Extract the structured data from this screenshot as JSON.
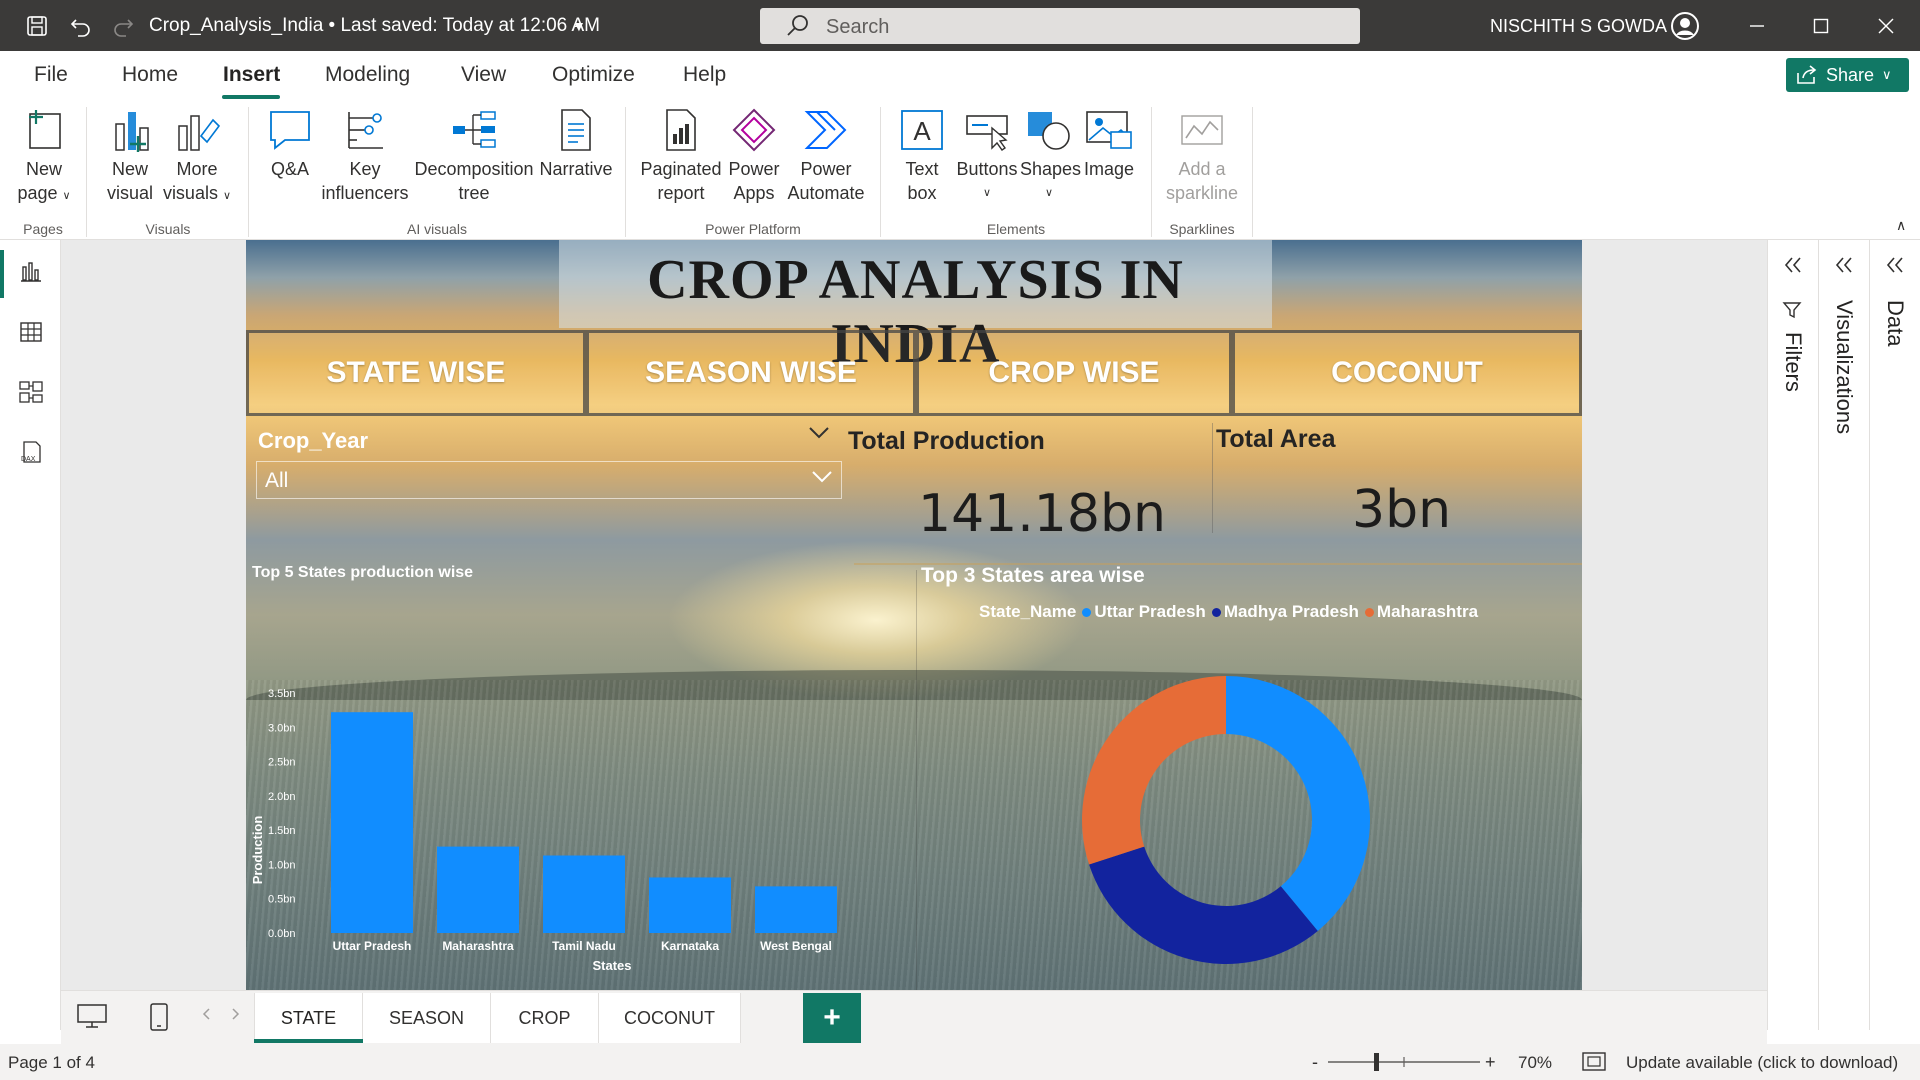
{
  "titlebar": {
    "doc_title": "Crop_Analysis_India • Last saved: Today at 12:06 AM",
    "search_placeholder": "Search",
    "user_name": "NISCHITH S GOWDA"
  },
  "menu": {
    "tabs": [
      "File",
      "Home",
      "Insert",
      "Modeling",
      "View",
      "Optimize",
      "Help"
    ],
    "active": "Insert",
    "share_label": "Share"
  },
  "ribbon": {
    "new_page": [
      "New",
      "page"
    ],
    "new_visual": [
      "New",
      "visual"
    ],
    "more_visuals": [
      "More",
      "visuals"
    ],
    "qa": [
      "Q&A"
    ],
    "key_influencers": [
      "Key",
      "influencers"
    ],
    "decomposition_tree": [
      "Decomposition",
      "tree"
    ],
    "narrative": [
      "Narrative"
    ],
    "paginated_report": [
      "Paginated",
      "report"
    ],
    "power_apps": [
      "Power",
      "Apps"
    ],
    "power_automate": [
      "Power",
      "Automate"
    ],
    "text_box": [
      "Text",
      "box"
    ],
    "buttons": [
      "Buttons"
    ],
    "shapes": [
      "Shapes"
    ],
    "image": [
      "Image"
    ],
    "add_sparkline": [
      "Add a",
      "sparkline"
    ],
    "groups": {
      "pages": "Pages",
      "visuals": "Visuals",
      "ai_visuals": "AI visuals",
      "power_platform": "Power Platform",
      "elements": "Elements",
      "sparklines": "Sparklines"
    }
  },
  "report": {
    "title": "CROP ANALYSIS IN INDIA",
    "nav_buttons": [
      "STATE WISE",
      "SEASON WISE",
      "CROP WISE",
      "COCONUT"
    ],
    "slicer": {
      "label": "Crop_Year",
      "value": "All"
    },
    "kpis": {
      "production_label": "Total Production",
      "production_value": "141.18bn",
      "area_label": "Total Area",
      "area_value": "3bn"
    },
    "bar_title": "Top 5 States production wise",
    "donut_title": "Top 3 States area wise",
    "legend_title": "State_Name"
  },
  "chart_data": [
    {
      "type": "bar",
      "title": "Top 5 States production wise",
      "categories": [
        "Uttar Pradesh",
        "Maharashtra",
        "Tamil Nadu",
        "Karnataka",
        "West Bengal"
      ],
      "values": [
        3.22,
        1.26,
        1.13,
        0.81,
        0.68
      ],
      "unit": "bn",
      "xlabel": "States",
      "ylabel": "Production",
      "ylim": [
        0,
        3.5
      ],
      "yticks": [
        "0.0bn",
        "0.5bn",
        "1.0bn",
        "1.5bn",
        "2.0bn",
        "2.5bn",
        "3.0bn",
        "3.5bn"
      ],
      "color": "#118dff"
    },
    {
      "type": "pie",
      "title": "Top 3 States area wise",
      "legend_title": "State_Name",
      "labels": [
        "Uttar Pradesh",
        "Madhya Pradesh",
        "Maharashtra"
      ],
      "values": [
        39,
        31,
        30
      ],
      "colors": [
        "#118dff",
        "#12239e",
        "#e66c37"
      ],
      "donut": true
    }
  ],
  "pages": {
    "tabs": [
      "STATE",
      "SEASON",
      "CROP",
      "COCONUT"
    ],
    "active": "STATE"
  },
  "panes": {
    "filters": "Filters",
    "visualizations": "Visualizations",
    "data": "Data"
  },
  "status": {
    "page_indicator": "Page 1 of 4",
    "zoom": "70%",
    "update_msg": "Update available (click to download)"
  },
  "colors": {
    "accent": "#117865",
    "titlebar": "#3b3a39"
  }
}
